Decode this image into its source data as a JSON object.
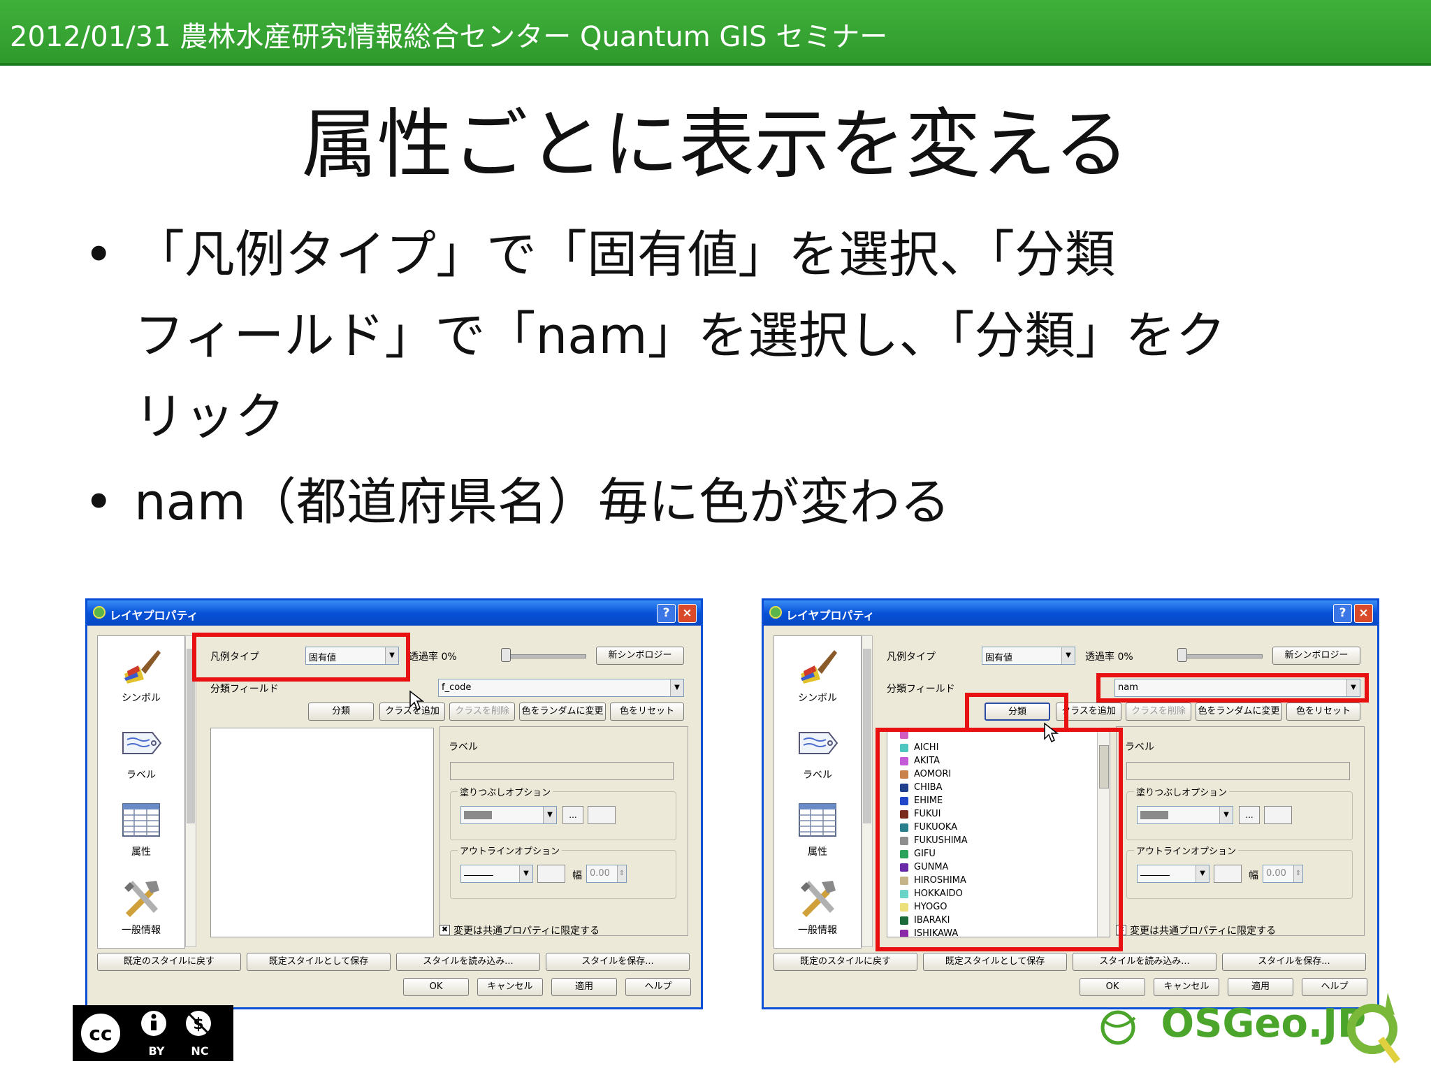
{
  "header": {
    "text": "2012/01/31 農林水産研究情報総合センター Quantum GIS セミナー"
  },
  "slide": {
    "title": "属性ごとに表示を変える",
    "bullets": [
      {
        "line1": "「凡例タイプ」で「固有値」を選択、「分類",
        "line2": "フィールド」で「nam」を選択し、「分類」をク",
        "line3": "リック"
      },
      {
        "line1": "nam（都道府県名）毎に色が変わる"
      }
    ],
    "bullet_symbol": "•"
  },
  "dialog": {
    "title": "レイヤプロパティ",
    "help": "?",
    "close": "×",
    "sidebar": [
      "シンボル",
      "ラベル",
      "属性",
      "一般情報"
    ],
    "legend_type_label": "凡例タイプ",
    "legend_type_value": "固有値",
    "transparency_label": "透過率 0%",
    "new_symbology": "新シンボロジー",
    "classify_field_label": "分類フィールド",
    "classify_field_left": "f_code",
    "classify_field_right": "nam",
    "buttons": {
      "classify": "分類",
      "add_class": "クラスを追加",
      "delete_class": "クラスを削除",
      "random_color": "色をランダムに変更",
      "reset_color": "色をリセット"
    },
    "label_heading": "ラベル",
    "fill_options": "塗りつぶしオプション",
    "outline_options": "アウトラインオプション",
    "width_label": "幅",
    "width_value": "0.00",
    "shared_props": "変更は共通プロパティに限定する",
    "check_mark": "✖",
    "ellipsis": "...",
    "bottom_buttons": [
      "既定のスタイルに戻す",
      "既定スタイルとして保存",
      "スタイルを読み込み...",
      "スタイルを保存..."
    ],
    "final_buttons": [
      "OK",
      "キャンセル",
      "適用",
      "ヘルプ"
    ]
  },
  "class_list": [
    {
      "name": "",
      "color": "#d05dbf"
    },
    {
      "name": "AICHI",
      "color": "#4fc7c0"
    },
    {
      "name": "AKITA",
      "color": "#c55ad8"
    },
    {
      "name": "AOMORI",
      "color": "#c8814a"
    },
    {
      "name": "CHIBA",
      "color": "#1f3f8c"
    },
    {
      "name": "EHIME",
      "color": "#2246c9"
    },
    {
      "name": "FUKUI",
      "color": "#7a2a1a"
    },
    {
      "name": "FUKUOKA",
      "color": "#2a7d8a"
    },
    {
      "name": "FUKUSHIMA",
      "color": "#8e8e8e"
    },
    {
      "name": "GIFU",
      "color": "#2aa25a"
    },
    {
      "name": "GUNMA",
      "color": "#6a2aa8"
    },
    {
      "name": "HIROSHIMA",
      "color": "#c5b48a"
    },
    {
      "name": "HOKKAIDO",
      "color": "#6ad4c8"
    },
    {
      "name": "HYOGO",
      "color": "#ece07a"
    },
    {
      "name": "IBARAKI",
      "color": "#1a6a3a"
    },
    {
      "name": "ISHIKAWA",
      "color": "#8a2aa8"
    }
  ],
  "logos": {
    "cc": [
      "BY",
      "NC"
    ],
    "cc_symbol": "cc",
    "osgeo": "OSGeo.JP"
  }
}
